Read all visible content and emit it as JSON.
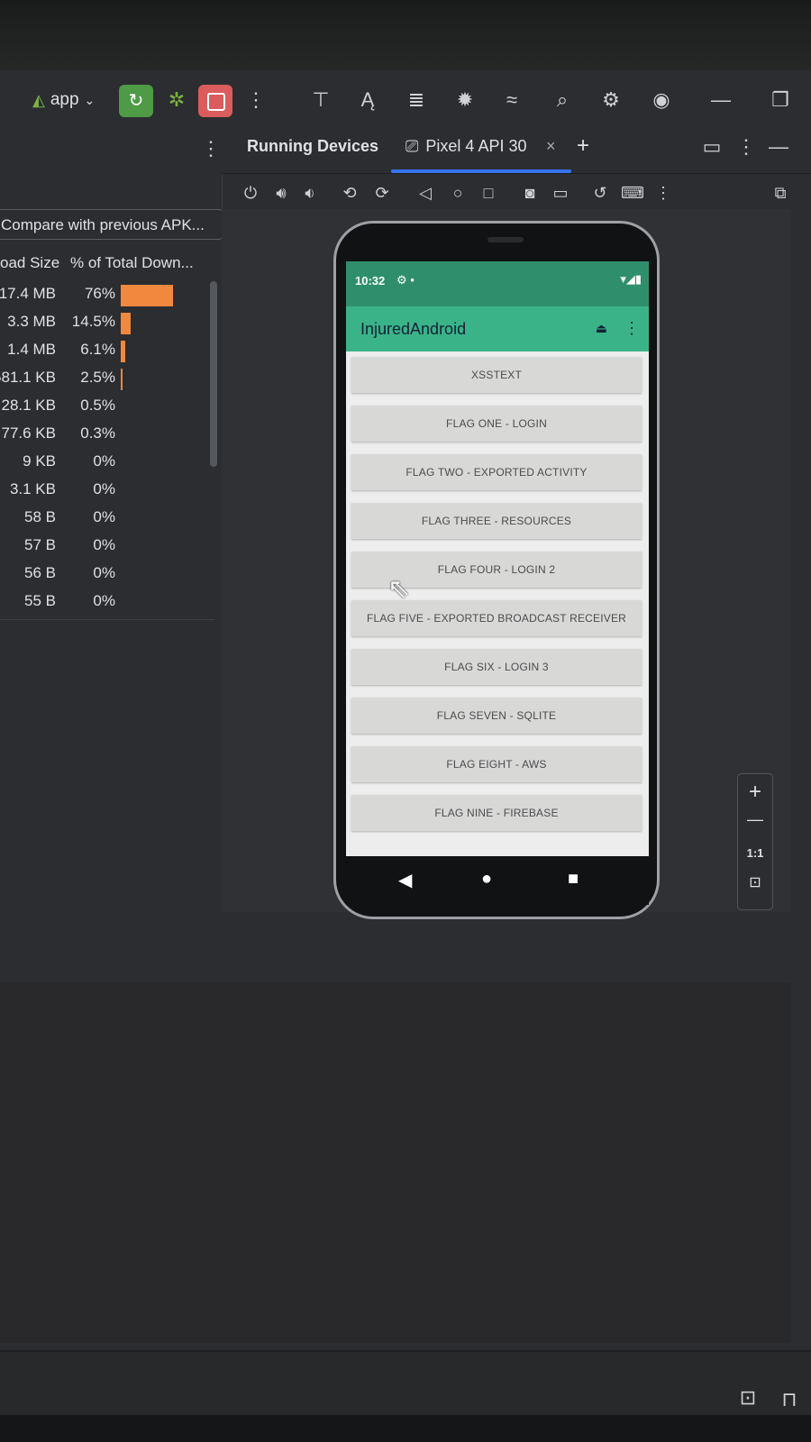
{
  "toolbar": {
    "app_label": "app",
    "icons": [
      "android-icon",
      "chevron-down-icon",
      "run-icon",
      "debug-icon",
      "stop-icon",
      "more-vert-icon",
      "layout-inspector-icon",
      "translate-icon",
      "logcat-icon",
      "bug-icon",
      "profiler-icon",
      "search-icon",
      "settings-icon",
      "account-icon",
      "minimize-icon",
      "restore-icon"
    ]
  },
  "analyzer": {
    "compare_button": "Compare with previous APK...",
    "col_size": "oad Size",
    "col_pct": "% of Total Down...",
    "rows": [
      {
        "size": "17.4 MB",
        "pct": "76%",
        "fraction": 0.76
      },
      {
        "size": "3.3 MB",
        "pct": "14.5%",
        "fraction": 0.145
      },
      {
        "size": "1.4 MB",
        "pct": "6.1%",
        "fraction": 0.061
      },
      {
        "size": "581.1 KB",
        "pct": "2.5%",
        "fraction": 0.025
      },
      {
        "size": "28.1 KB",
        "pct": "0.5%",
        "fraction": 0.005
      },
      {
        "size": "77.6 KB",
        "pct": "0.3%",
        "fraction": 0.003
      },
      {
        "size": "9 KB",
        "pct": "0%",
        "fraction": 0
      },
      {
        "size": "3.1 KB",
        "pct": "0%",
        "fraction": 0
      },
      {
        "size": "58 B",
        "pct": "0%",
        "fraction": 0
      },
      {
        "size": "57 B",
        "pct": "0%",
        "fraction": 0
      },
      {
        "size": "56 B",
        "pct": "0%",
        "fraction": 0
      },
      {
        "size": "55 B",
        "pct": "0%",
        "fraction": 0
      }
    ]
  },
  "devices": {
    "tab_running": "Running Devices",
    "tab_pixel": "Pixel 4 API 30",
    "close": "×",
    "add": "+"
  },
  "phone": {
    "time": "10:32",
    "status_right": "▾◢▮",
    "app_title": "InjuredAndroid",
    "flags": [
      "XSSTEXT",
      "FLAG ONE - LOGIN",
      "FLAG TWO - EXPORTED ACTIVITY",
      "FLAG THREE - RESOURCES",
      "FLAG FOUR - LOGIN 2",
      "FLAG FIVE - EXPORTED BROADCAST RECEIVER",
      "FLAG SIX - LOGIN 3",
      "FLAG SEVEN - SQLITE",
      "FLAG EIGHT - AWS",
      "FLAG NINE - FIREBASE"
    ]
  },
  "zoom": {
    "plus": "+",
    "minus": "—",
    "one_to_one": "1:1"
  },
  "colors": {
    "accent": "#3574f0",
    "run": "#4e9a46",
    "stop": "#db5c5c",
    "bar": "#f0883e",
    "status_bar": "#2f8f6d",
    "app_bar": "#3bb389"
  }
}
